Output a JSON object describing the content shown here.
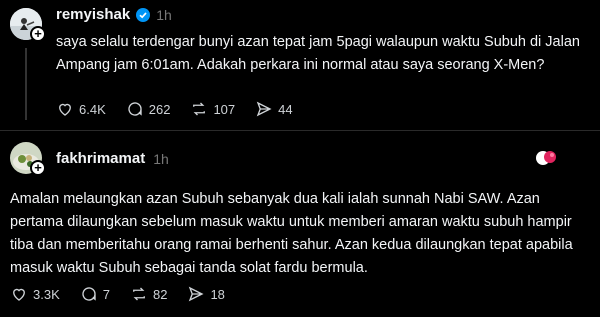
{
  "posts": [
    {
      "username": "remyishak",
      "verified": true,
      "time": "1h",
      "text": "saya selalu terdengar bunyi azan tepat jam 5pagi walaupun waktu Subuh di Jalan Ampang jam 6:01am. Adakah perkara ini normal atau saya seorang X-Men?",
      "likes": "6.4K",
      "comments": "262",
      "reposts": "107",
      "shares": "44"
    },
    {
      "username": "fakhrimamat",
      "verified": false,
      "time": "1h",
      "text": "Amalan melaungkan azan Subuh sebanyak dua kali ialah sunnah Nabi SAW. Azan pertama dilaungkan sebelum masuk waktu untuk memberi amaran waktu subuh hampir tiba dan memberitahu orang ramai berhenti sahur. Azan kedua dilaungkan tepat apabila masuk waktu Subuh sebagai tanda solat fardu bermula.",
      "likes": "3.3K",
      "comments": "7",
      "reposts": "82",
      "shares": "18"
    }
  ],
  "colors": {
    "background": "#000000",
    "text": "#f3f5f7",
    "muted": "#777777",
    "verified": "#0095f6"
  }
}
